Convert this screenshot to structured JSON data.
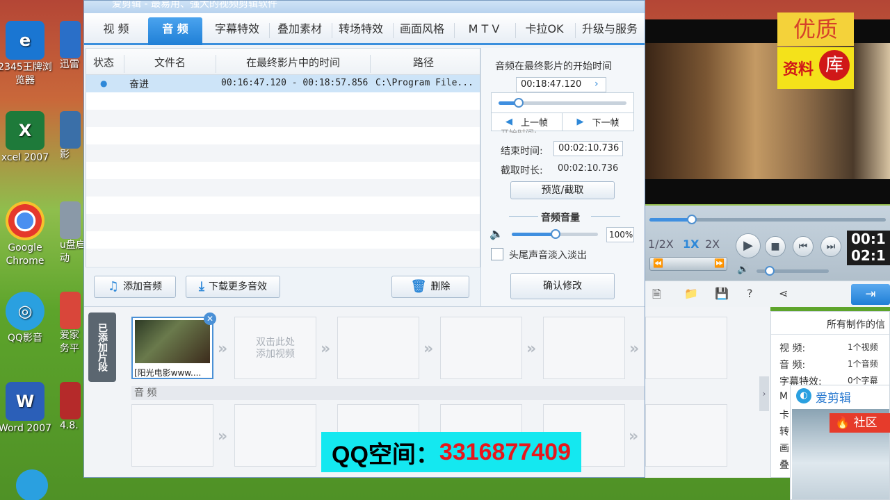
{
  "desktop": {
    "icons": [
      {
        "label": "2345王牌浏\n览器",
        "color": "#1a76d2",
        "glyph": "e"
      },
      {
        "label": "xcel 2007",
        "color": "#1e7a3a",
        "glyph": "X"
      },
      {
        "label": "Google\nChrome",
        "color": "#e5382b",
        "glyph": "◉"
      },
      {
        "label": "QQ影音",
        "color": "#2aa0e0",
        "glyph": "◎"
      },
      {
        "label": "Word 2007",
        "color": "#2b5fb8",
        "glyph": "W"
      }
    ],
    "clipped": [
      "迅雷",
      "影",
      "u盘启\n动",
      "爱家\n务平",
      "4.8."
    ]
  },
  "window": {
    "title": "爱剪辑 - 最易用、强大的视频剪辑软件",
    "tabs": [
      "视 频",
      "音 频",
      "字幕特效",
      "叠加素材",
      "转场特效",
      "画面风格",
      "M T V",
      "卡拉OK",
      "升级与服务"
    ],
    "active_tab": "音 频"
  },
  "audio_list": {
    "headers": [
      "状态",
      "文件名",
      "在最终影片中的时间",
      "路径"
    ],
    "rows": [
      {
        "status": "●",
        "name": "奋进",
        "time": "00:16:47.120 - 00:18:57.856",
        "path": "C:\\Program File..."
      }
    ]
  },
  "buttons": {
    "add_audio": "添加音频",
    "download_more": "下载更多音效",
    "delete": "删除"
  },
  "audio_settings": {
    "start_time_title": "音频在最终影片的开始时间",
    "start_time_value": "00:18:47.120",
    "prev_frame": "上一帧",
    "next_frame": "下一帧",
    "start_label": "开始时间:",
    "end_label": "结束时间:",
    "end_value": "00:02:10.736",
    "duration_label": "截取时长:",
    "duration_value": "00:02:10.736",
    "preview_clip": "预览/截取",
    "volume_title": "音频音量",
    "volume_value": "100%",
    "fade_label": "头尾声音淡入淡出",
    "confirm": "确认修改"
  },
  "player": {
    "speeds": [
      "1/2X",
      "1X",
      "2X"
    ],
    "active_speed": "1X",
    "time_current": "00:1",
    "time_total": "02:1"
  },
  "timeline": {
    "side_tab": "已添加片段",
    "clip_name": "[阳光电影www....",
    "empty_slot_text": "双击此处\n添加视频",
    "audio_section": "音 频"
  },
  "stats": {
    "title": "所有制作的信",
    "rows": [
      {
        "label": "视    频:",
        "value": "1个视频"
      },
      {
        "label": "音    频:",
        "value": "1个音频"
      },
      {
        "label": "字幕特效:",
        "value": "0个字幕"
      },
      {
        "label": "M",
        "value": ""
      },
      {
        "label": "卡",
        "value": ""
      },
      {
        "label": "转",
        "value": ""
      },
      {
        "label": "画",
        "value": ""
      },
      {
        "label": "叠",
        "value": ""
      }
    ]
  },
  "popup": {
    "brand": "爱剪辑",
    "community": "社区"
  },
  "watermark": {
    "top": "优质",
    "bottom_left": "资料",
    "bottom_right": "库"
  },
  "overlay": {
    "label": "QQ空间：",
    "number": "3316877409"
  },
  "colors": {
    "accent": "#1f7fd6",
    "overlay_bg": "#14e8f0",
    "overlay_number": "#e8161b"
  }
}
